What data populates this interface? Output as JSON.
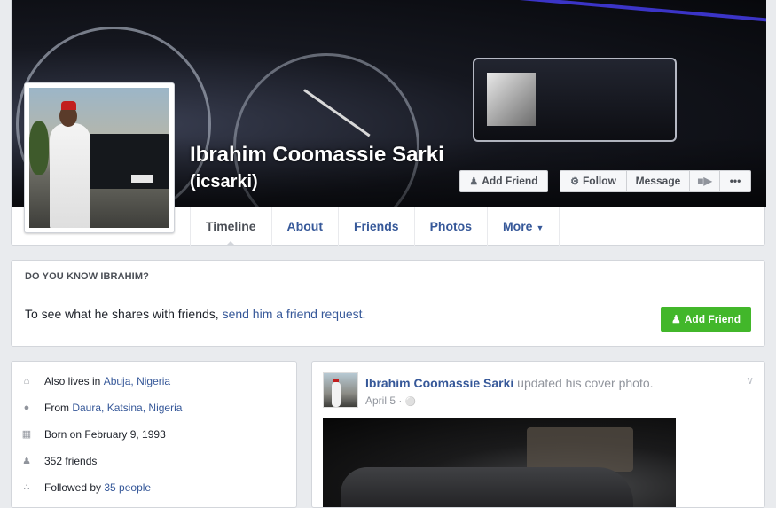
{
  "profile": {
    "name": "Ibrahim Coomassie Sarki",
    "username": "(icsarki)"
  },
  "actions": {
    "add_friend": "Add Friend",
    "follow": "Follow",
    "message": "Message",
    "more_dots": "•••"
  },
  "tabs": [
    {
      "label": "Timeline",
      "active": true
    },
    {
      "label": "About"
    },
    {
      "label": "Friends"
    },
    {
      "label": "Photos"
    },
    {
      "label": "More"
    }
  ],
  "know": {
    "heading": "DO YOU KNOW IBRAHIM?",
    "text": "To see what he shares with friends, ",
    "link": "send him a friend request.",
    "button": "Add Friend"
  },
  "intro": {
    "lives_prefix": "Also lives in ",
    "lives_place": "Abuja, Nigeria",
    "from_prefix": "From ",
    "from_city": "Daura",
    "from_sep": ", ",
    "from_region": "Katsina, Nigeria",
    "born": "Born on February 9, 1993",
    "friends": "352 friends",
    "followed_prefix": "Followed by ",
    "followed_link": "35 people"
  },
  "post": {
    "author": "Ibrahim Coomassie Sarki",
    "action": " updated his cover photo.",
    "date": "April 5 · ",
    "privacy_icon": "globe-icon"
  },
  "icons": {
    "add_friend": "person-plus-icon",
    "follow": "rss-icon",
    "video": "video-camera-icon",
    "lives": "house-icon",
    "from": "map-pin-icon",
    "born": "calendar-icon",
    "friends": "people-icon",
    "followed": "feed-icon"
  },
  "colors": {
    "link": "#365899",
    "green_button": "#42b72a",
    "background": "#e9ebee"
  }
}
